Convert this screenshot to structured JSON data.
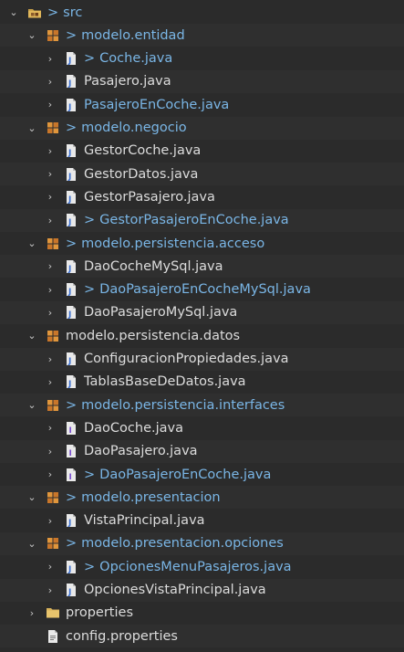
{
  "explorer": {
    "rows": [
      {
        "label": "src",
        "icon": "source-folder-icon",
        "indent": 0,
        "twisty": "expanded",
        "decoration": ">",
        "dirty": true
      },
      {
        "label": "modelo.entidad",
        "icon": "package-icon",
        "indent": 1,
        "twisty": "expanded",
        "decoration": ">",
        "dirty": true
      },
      {
        "label": "Coche.java",
        "icon": "java-file-icon",
        "indent": 2,
        "twisty": "collapsed",
        "decoration": ">",
        "dirty": true
      },
      {
        "label": "Pasajero.java",
        "icon": "java-file-icon",
        "indent": 2,
        "twisty": "collapsed",
        "decoration": "",
        "dirty": false
      },
      {
        "label": "PasajeroEnCoche.java",
        "icon": "java-file-icon",
        "indent": 2,
        "twisty": "collapsed",
        "decoration": "",
        "dirty": true
      },
      {
        "label": "modelo.negocio",
        "icon": "package-icon",
        "indent": 1,
        "twisty": "expanded",
        "decoration": ">",
        "dirty": true
      },
      {
        "label": "GestorCoche.java",
        "icon": "java-file-icon",
        "indent": 2,
        "twisty": "collapsed",
        "decoration": "",
        "dirty": false
      },
      {
        "label": "GestorDatos.java",
        "icon": "java-file-icon",
        "indent": 2,
        "twisty": "collapsed",
        "decoration": "",
        "dirty": false
      },
      {
        "label": "GestorPasajero.java",
        "icon": "java-file-icon",
        "indent": 2,
        "twisty": "collapsed",
        "decoration": "",
        "dirty": false
      },
      {
        "label": "GestorPasajeroEnCoche.java",
        "icon": "java-file-icon",
        "indent": 2,
        "twisty": "collapsed",
        "decoration": ">",
        "dirty": true
      },
      {
        "label": "modelo.persistencia.acceso",
        "icon": "package-icon",
        "indent": 1,
        "twisty": "expanded",
        "decoration": ">",
        "dirty": true
      },
      {
        "label": "DaoCocheMySql.java",
        "icon": "java-file-icon",
        "indent": 2,
        "twisty": "collapsed",
        "decoration": "",
        "dirty": false
      },
      {
        "label": "DaoPasajeroEnCocheMySql.java",
        "icon": "java-file-icon",
        "indent": 2,
        "twisty": "collapsed",
        "decoration": ">",
        "dirty": true
      },
      {
        "label": "DaoPasajeroMySql.java",
        "icon": "java-file-icon",
        "indent": 2,
        "twisty": "collapsed",
        "decoration": "",
        "dirty": false
      },
      {
        "label": "modelo.persistencia.datos",
        "icon": "package-icon",
        "indent": 1,
        "twisty": "expanded",
        "decoration": "",
        "dirty": false
      },
      {
        "label": "ConfiguracionPropiedades.java",
        "icon": "java-file-icon",
        "indent": 2,
        "twisty": "collapsed",
        "decoration": "",
        "dirty": false
      },
      {
        "label": "TablasBaseDeDatos.java",
        "icon": "java-file-icon",
        "indent": 2,
        "twisty": "collapsed",
        "decoration": "",
        "dirty": false
      },
      {
        "label": "modelo.persistencia.interfaces",
        "icon": "package-icon",
        "indent": 1,
        "twisty": "expanded",
        "decoration": ">",
        "dirty": true
      },
      {
        "label": "DaoCoche.java",
        "icon": "java-interface-icon",
        "indent": 2,
        "twisty": "collapsed",
        "decoration": "",
        "dirty": false
      },
      {
        "label": "DaoPasajero.java",
        "icon": "java-interface-icon",
        "indent": 2,
        "twisty": "collapsed",
        "decoration": "",
        "dirty": false
      },
      {
        "label": "DaoPasajeroEnCoche.java",
        "icon": "java-interface-icon",
        "indent": 2,
        "twisty": "collapsed",
        "decoration": ">",
        "dirty": true
      },
      {
        "label": "modelo.presentacion",
        "icon": "package-icon",
        "indent": 1,
        "twisty": "expanded",
        "decoration": ">",
        "dirty": true
      },
      {
        "label": "VistaPrincipal.java",
        "icon": "java-file-icon",
        "indent": 2,
        "twisty": "collapsed",
        "decoration": "",
        "dirty": false
      },
      {
        "label": "modelo.presentacion.opciones",
        "icon": "package-icon",
        "indent": 1,
        "twisty": "expanded",
        "decoration": ">",
        "dirty": true
      },
      {
        "label": "OpcionesMenuPasajeros.java",
        "icon": "java-file-icon",
        "indent": 2,
        "twisty": "collapsed",
        "decoration": ">",
        "dirty": true
      },
      {
        "label": "OpcionesVistaPrincipal.java",
        "icon": "java-file-icon",
        "indent": 2,
        "twisty": "collapsed",
        "decoration": "",
        "dirty": false
      },
      {
        "label": "properties",
        "icon": "folder-icon",
        "indent": 1,
        "twisty": "collapsed",
        "decoration": "",
        "dirty": false
      },
      {
        "label": "config.properties",
        "icon": "properties-file-icon",
        "indent": 1,
        "twisty": "none",
        "decoration": "",
        "dirty": false
      }
    ]
  },
  "colors": {
    "background": "#2b2b2b",
    "text": "#dcdcdc",
    "dirty_text": "#7ab6e6",
    "package_orange": "#e0963c",
    "java_blue": "#6da5e8"
  }
}
